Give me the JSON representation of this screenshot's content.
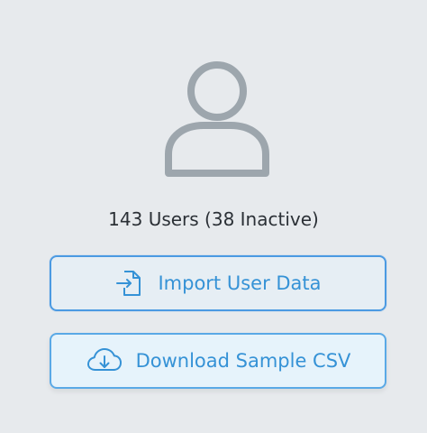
{
  "summary": {
    "users_text": "143 Users (38 Inactive)"
  },
  "actions": {
    "import_label": "Import User Data",
    "download_label": "Download Sample CSV"
  },
  "icons": {
    "avatar": "user-icon",
    "import": "file-import-icon",
    "download": "cloud-download-icon"
  },
  "colors": {
    "accent": "#3592d6",
    "avatar_stroke": "#9da6ad",
    "background": "#e7eaed"
  }
}
